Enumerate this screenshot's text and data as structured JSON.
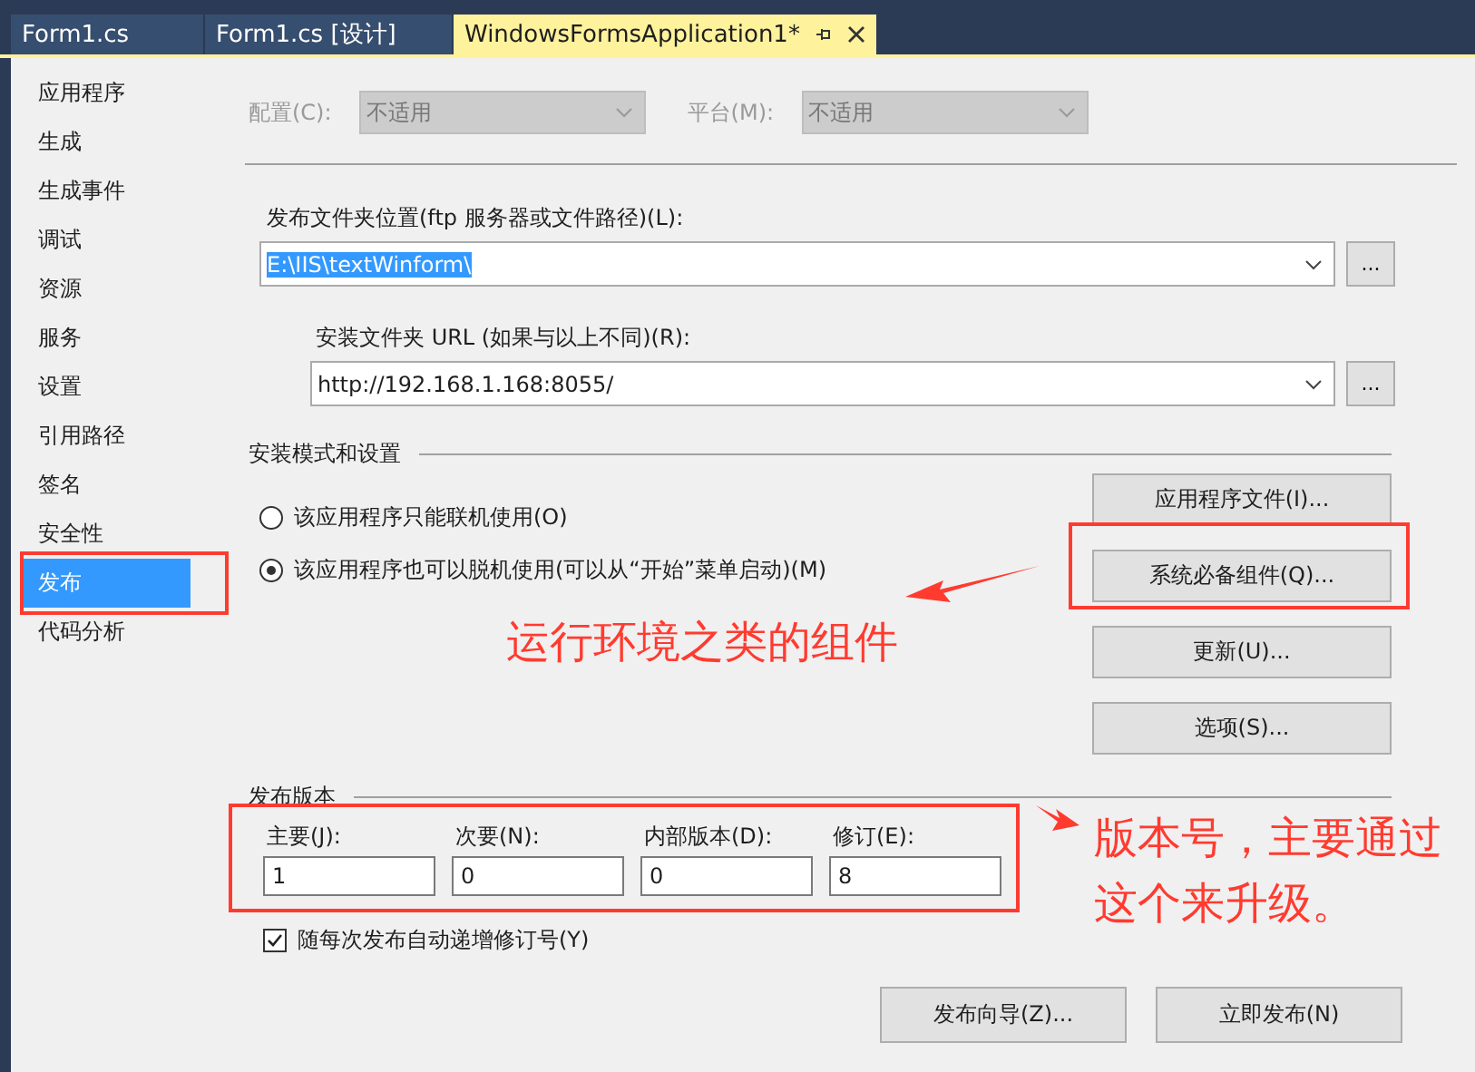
{
  "tabs": [
    {
      "label": "Form1.cs",
      "selected": false
    },
    {
      "label": "Form1.cs [设计]",
      "selected": false
    },
    {
      "label": "WindowsFormsApplication1*",
      "selected": true
    }
  ],
  "sidebar": {
    "items": [
      {
        "label": "应用程序",
        "selected": false
      },
      {
        "label": "生成",
        "selected": false
      },
      {
        "label": "生成事件",
        "selected": false
      },
      {
        "label": "调试",
        "selected": false
      },
      {
        "label": "资源",
        "selected": false
      },
      {
        "label": "服务",
        "selected": false
      },
      {
        "label": "设置",
        "selected": false
      },
      {
        "label": "引用路径",
        "selected": false
      },
      {
        "label": "签名",
        "selected": false
      },
      {
        "label": "安全性",
        "selected": false
      },
      {
        "label": "发布",
        "selected": true
      },
      {
        "label": "代码分析",
        "selected": false
      }
    ]
  },
  "config": {
    "label": "配置(C):",
    "value": "不适用",
    "disabled": true
  },
  "platform": {
    "label": "平台(M):",
    "value": "不适用",
    "disabled": true
  },
  "publish_location": {
    "label": "发布文件夹位置(ftp 服务器或文件路径)(L):",
    "value": "E:\\IIS\\textWinform\\",
    "browse": "..."
  },
  "install_url": {
    "label": "安装文件夹 URL (如果与以上不同)(R):",
    "value": "http://192.168.1.168:8055/",
    "browse": "..."
  },
  "install_mode": {
    "title": "安装模式和设置",
    "options": [
      {
        "label": "该应用程序只能联机使用(O)",
        "selected": false
      },
      {
        "label": "该应用程序也可以脱机使用(可以从“开始”菜单启动)(M)",
        "selected": true
      }
    ],
    "buttons": [
      "应用程序文件(I)...",
      "系统必备组件(Q)...",
      "更新(U)...",
      "选项(S)..."
    ]
  },
  "version": {
    "title": "发布版本",
    "fields": [
      {
        "label": "主要(J):",
        "value": "1"
      },
      {
        "label": "次要(N):",
        "value": "0"
      },
      {
        "label": "内部版本(D):",
        "value": "0"
      },
      {
        "label": "修订(E):",
        "value": "8"
      }
    ],
    "auto_increment": {
      "label": "随每次发布自动递增修订号(Y)",
      "checked": true
    }
  },
  "buttons": [
    "发布向导(Z)...",
    "立即发布(N)"
  ],
  "annotations": [
    "运行环境之类的组件",
    "版本号，主要通过这个来升级。"
  ]
}
